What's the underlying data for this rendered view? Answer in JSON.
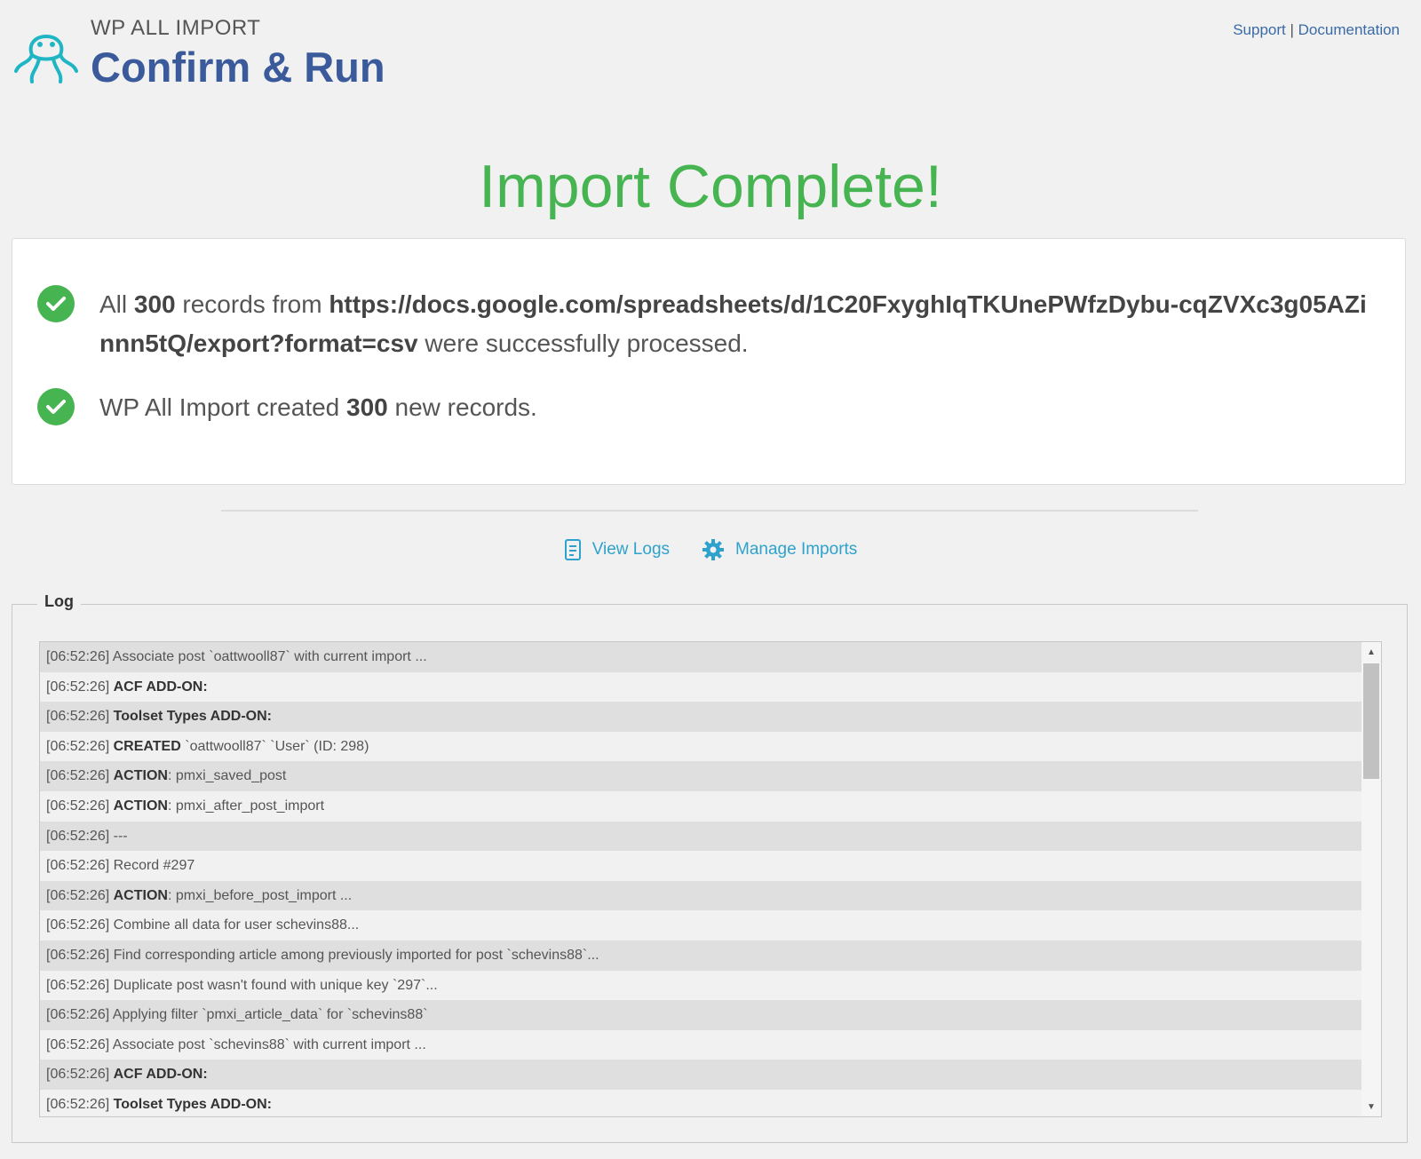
{
  "header": {
    "brand_small": "WP ALL IMPORT",
    "brand_title": "Confirm & Run",
    "support_link": "Support",
    "separator": "|",
    "documentation_link": "Documentation"
  },
  "status_title": "Import Complete!",
  "summary": {
    "line1": {
      "prefix": "All ",
      "count": "300",
      "middle": " records from ",
      "source": "https://docs.google.com/spreadsheets/d/1C20FxyghIqTKUnePWfzDybu-cqZVXc3g05AZinnn5tQ/export?format=csv",
      "suffix": " were successfully processed."
    },
    "line2": {
      "prefix": "WP All Import created ",
      "count": "300",
      "suffix": " new records."
    }
  },
  "actions": {
    "view_logs": "View Logs",
    "manage_imports": "Manage Imports"
  },
  "log": {
    "legend": "Log",
    "rows": [
      {
        "time": "[06:52:26]",
        "bold": "",
        "text": "Associate post `oattwooll87` with current import ..."
      },
      {
        "time": "[06:52:26]",
        "bold": "ACF ADD-ON:",
        "text": ""
      },
      {
        "time": "[06:52:26]",
        "bold": "Toolset Types ADD-ON:",
        "text": ""
      },
      {
        "time": "[06:52:26]",
        "bold": "CREATED",
        "text": "`oattwooll87` `User` (ID: 298)"
      },
      {
        "time": "[06:52:26]",
        "bold": "ACTION",
        "text": ": pmxi_saved_post"
      },
      {
        "time": "[06:52:26]",
        "bold": "ACTION",
        "text": ": pmxi_after_post_import"
      },
      {
        "time": "[06:52:26]",
        "bold": "",
        "text": "---"
      },
      {
        "time": "[06:52:26]",
        "bold": "",
        "text": "Record #297"
      },
      {
        "time": "[06:52:26]",
        "bold": "ACTION",
        "text": ": pmxi_before_post_import ..."
      },
      {
        "time": "[06:52:26]",
        "bold": "",
        "text": "Combine all data for user schevins88..."
      },
      {
        "time": "[06:52:26]",
        "bold": "",
        "text": "Find corresponding article among previously imported for post `schevins88`..."
      },
      {
        "time": "[06:52:26]",
        "bold": "",
        "text": "Duplicate post wasn't found with unique key `297`..."
      },
      {
        "time": "[06:52:26]",
        "bold": "",
        "text": "Applying filter `pmxi_article_data` for `schevins88`"
      },
      {
        "time": "[06:52:26]",
        "bold": "",
        "text": "Associate post `schevins88` with current import ..."
      },
      {
        "time": "[06:52:26]",
        "bold": "ACF ADD-ON:",
        "text": ""
      },
      {
        "time": "[06:52:26]",
        "bold": "Toolset Types ADD-ON:",
        "text": ""
      }
    ]
  },
  "colors": {
    "success": "#46b450",
    "brand": "#3a5a9b",
    "link": "#2ea2cc",
    "logo": "#1fb5c5"
  }
}
